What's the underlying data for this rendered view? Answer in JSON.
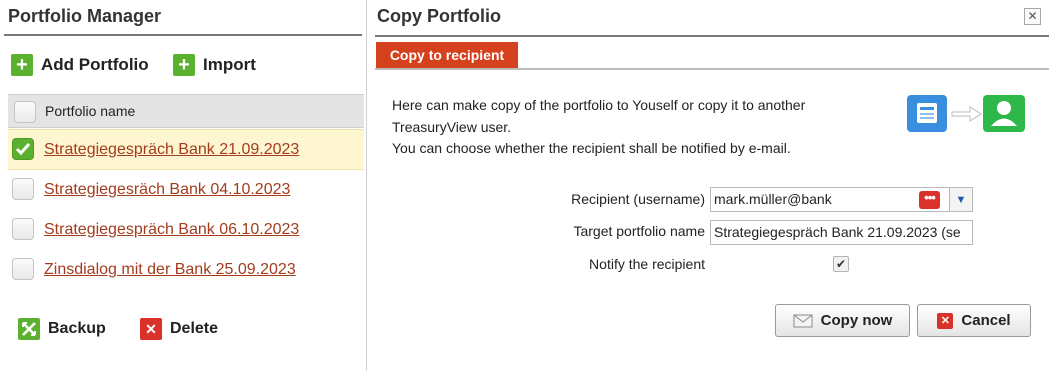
{
  "left_panel": {
    "title": "Portfolio Manager",
    "add_label": "Add Portfolio",
    "import_label": "Import",
    "column_header": "Portfolio name",
    "rows": [
      {
        "name": "Strategiegespräch Bank 21.09.2023",
        "checked": true
      },
      {
        "name": "Strategiegesräch Bank 04.10.2023",
        "checked": false
      },
      {
        "name": "Strategiegespräch Bank 06.10.2023",
        "checked": false
      },
      {
        "name": "Zinsdialog mit der Bank 25.09.2023",
        "checked": false
      }
    ],
    "backup_label": "Backup",
    "delete_label": "Delete"
  },
  "dialog": {
    "title": "Copy Portfolio",
    "close_glyph": "✕",
    "tab_label": "Copy to recipient",
    "intro_lines": [
      "Here can make copy of the portfolio to Youself or copy it to another",
      "TreasuryView user.",
      "You can choose whether the recipient shall be notified by e-mail."
    ],
    "recipient_label": "Recipient (username)",
    "recipient_value": "mark.müller@bank",
    "recipient_dots": "•••",
    "target_label": "Target portfolio name",
    "target_value": "Strategiegespräch Bank 21.09.2023 (se",
    "notify_label": "Notify the recipient",
    "notify_checked": true,
    "copy_button": "Copy now",
    "cancel_button": "Cancel"
  },
  "colors": {
    "accent_red": "#d5401d",
    "green": "#5bb12f",
    "link": "#a33c1e"
  }
}
